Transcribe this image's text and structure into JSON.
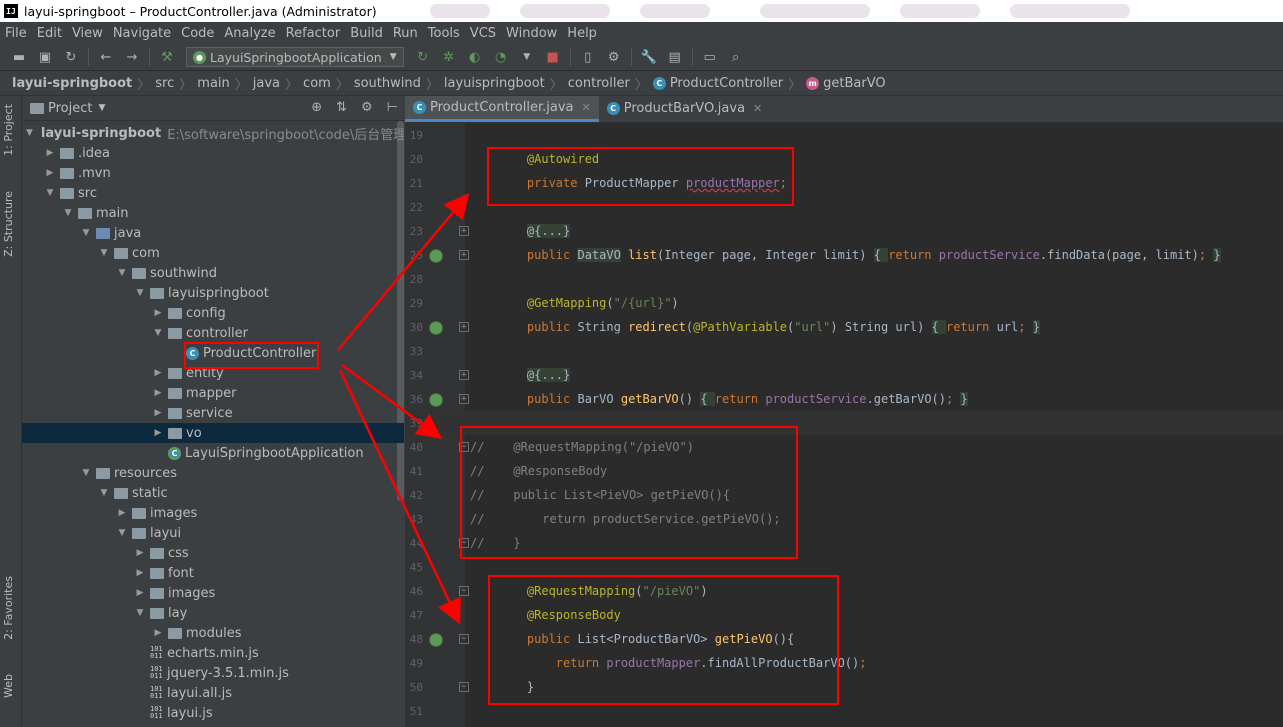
{
  "window": {
    "title": "layui-springboot – ProductController.java (Administrator)"
  },
  "menu": [
    "File",
    "Edit",
    "View",
    "Navigate",
    "Code",
    "Analyze",
    "Refactor",
    "Build",
    "Run",
    "Tools",
    "VCS",
    "Window",
    "Help"
  ],
  "toolbar": {
    "run_config": "LayuiSpringbootApplication"
  },
  "breadcrumb": [
    "layui-springboot",
    "src",
    "main",
    "java",
    "com",
    "southwind",
    "layuispringboot",
    "controller",
    "ProductController",
    "getBarVO"
  ],
  "left_strip": {
    "project": "1: Project",
    "structure": "Z: Structure",
    "favorites": "2: Favorites",
    "web": "Web"
  },
  "project_panel": {
    "title": "Project",
    "root_path": "E:\\software\\springboot\\code\\后台管理\\",
    "tree": [
      {
        "label": "layui-springboot",
        "depth": 0,
        "kind": "module",
        "open": true
      },
      {
        "label": ".idea",
        "depth": 1,
        "kind": "folder",
        "open": false
      },
      {
        "label": ".mvn",
        "depth": 1,
        "kind": "folder",
        "open": false
      },
      {
        "label": "src",
        "depth": 1,
        "kind": "folder",
        "open": true
      },
      {
        "label": "main",
        "depth": 2,
        "kind": "folder",
        "open": true
      },
      {
        "label": "java",
        "depth": 3,
        "kind": "srcfolder",
        "open": true
      },
      {
        "label": "com",
        "depth": 4,
        "kind": "package",
        "open": true
      },
      {
        "label": "southwind",
        "depth": 5,
        "kind": "package",
        "open": true
      },
      {
        "label": "layuispringboot",
        "depth": 6,
        "kind": "package",
        "open": true
      },
      {
        "label": "config",
        "depth": 7,
        "kind": "package",
        "open": false
      },
      {
        "label": "controller",
        "depth": 7,
        "kind": "package",
        "open": true
      },
      {
        "label": "ProductController",
        "depth": 8,
        "kind": "class",
        "open": null
      },
      {
        "label": "entity",
        "depth": 7,
        "kind": "package",
        "open": false
      },
      {
        "label": "mapper",
        "depth": 7,
        "kind": "package",
        "open": false
      },
      {
        "label": "service",
        "depth": 7,
        "kind": "package",
        "open": false
      },
      {
        "label": "vo",
        "depth": 7,
        "kind": "package",
        "open": false,
        "selected": true
      },
      {
        "label": "LayuiSpringbootApplication",
        "depth": 7,
        "kind": "springclass",
        "open": null
      },
      {
        "label": "resources",
        "depth": 3,
        "kind": "folder",
        "open": true
      },
      {
        "label": "static",
        "depth": 4,
        "kind": "folder",
        "open": true
      },
      {
        "label": "images",
        "depth": 5,
        "kind": "folder",
        "open": false
      },
      {
        "label": "layui",
        "depth": 5,
        "kind": "folder",
        "open": true
      },
      {
        "label": "css",
        "depth": 6,
        "kind": "folder",
        "open": false
      },
      {
        "label": "font",
        "depth": 6,
        "kind": "folder",
        "open": false
      },
      {
        "label": "images",
        "depth": 6,
        "kind": "folder",
        "open": false
      },
      {
        "label": "lay",
        "depth": 6,
        "kind": "folder",
        "open": true
      },
      {
        "label": "modules",
        "depth": 7,
        "kind": "folder",
        "open": false
      },
      {
        "label": "echarts.min.js",
        "depth": 6,
        "kind": "js",
        "open": null
      },
      {
        "label": "jquery-3.5.1.min.js",
        "depth": 6,
        "kind": "js",
        "open": null
      },
      {
        "label": "layui.all.js",
        "depth": 6,
        "kind": "js",
        "open": null
      },
      {
        "label": "layui.js",
        "depth": 6,
        "kind": "js",
        "open": null
      }
    ]
  },
  "editor": {
    "tabs": [
      {
        "label": "ProductController.java",
        "active": true
      },
      {
        "label": "ProductBarVO.java",
        "active": false
      }
    ],
    "lines": [
      {
        "n": "19",
        "segs": []
      },
      {
        "n": "20",
        "segs": [
          {
            "t": "    "
          },
          {
            "t": "@Autowired",
            "c": "an"
          }
        ]
      },
      {
        "n": "21",
        "segs": [
          {
            "t": "    "
          },
          {
            "t": "private ",
            "c": "kw"
          },
          {
            "t": "ProductMapper "
          },
          {
            "t": "productMapper",
            "c": "fld ul"
          },
          {
            "t": ";",
            "c": "kw"
          }
        ]
      },
      {
        "n": "22",
        "segs": []
      },
      {
        "n": "23",
        "segs": [
          {
            "t": "    "
          },
          {
            "t": "@{...}",
            "c": "hl"
          }
        ],
        "fold": "+"
      },
      {
        "n": "25",
        "segs": [
          {
            "t": "    "
          },
          {
            "t": "public ",
            "c": "kw"
          },
          {
            "t": "DataVO",
            "c": "hl"
          },
          {
            "t": " "
          },
          {
            "t": "list",
            "c": "fn"
          },
          {
            "t": "(Integer page, Integer limit) "
          },
          {
            "t": "{ ",
            "c": "hl"
          },
          {
            "t": "return ",
            "c": "kw"
          },
          {
            "t": "productService",
            "c": "fld"
          },
          {
            "t": ".findData(page, limit)"
          },
          {
            "t": "; ",
            "c": "kw"
          },
          {
            "t": "}",
            "c": "hl"
          }
        ],
        "fold": "+",
        "gicon": true
      },
      {
        "n": "28",
        "segs": []
      },
      {
        "n": "29",
        "segs": [
          {
            "t": "    "
          },
          {
            "t": "@GetMapping",
            "c": "an"
          },
          {
            "t": "("
          },
          {
            "t": "\"/{url}\"",
            "c": "st"
          },
          {
            "t": ")"
          }
        ]
      },
      {
        "n": "30",
        "segs": [
          {
            "t": "    "
          },
          {
            "t": "public ",
            "c": "kw"
          },
          {
            "t": "String "
          },
          {
            "t": "redirect",
            "c": "fn"
          },
          {
            "t": "("
          },
          {
            "t": "@PathVariable",
            "c": "an"
          },
          {
            "t": "("
          },
          {
            "t": "\"url\"",
            "c": "st"
          },
          {
            "t": ") String url) "
          },
          {
            "t": "{ ",
            "c": "hl"
          },
          {
            "t": "return ",
            "c": "kw"
          },
          {
            "t": "url"
          },
          {
            "t": "; ",
            "c": "kw"
          },
          {
            "t": "}",
            "c": "hl"
          }
        ],
        "fold": "+",
        "gicon": true
      },
      {
        "n": "33",
        "segs": []
      },
      {
        "n": "34",
        "segs": [
          {
            "t": "    "
          },
          {
            "t": "@{...}",
            "c": "hl"
          }
        ],
        "fold": "+"
      },
      {
        "n": "36",
        "segs": [
          {
            "t": "    "
          },
          {
            "t": "public ",
            "c": "kw"
          },
          {
            "t": "BarVO "
          },
          {
            "t": "getBarVO",
            "c": "fn"
          },
          {
            "t": "() "
          },
          {
            "t": "{ ",
            "c": "hl"
          },
          {
            "t": "return ",
            "c": "kw"
          },
          {
            "t": "productService",
            "c": "fld"
          },
          {
            "t": ".getBarVO()"
          },
          {
            "t": "; ",
            "c": "kw"
          },
          {
            "t": "}",
            "c": "hl"
          }
        ],
        "fold": "+",
        "gicon": true
      },
      {
        "n": "39",
        "segs": [],
        "cur": true
      },
      {
        "n": "40",
        "segs": [
          {
            "t": "//    @RequestMapping(\"/pieVO\")",
            "c": "cm"
          }
        ],
        "fold": "-"
      },
      {
        "n": "41",
        "segs": [
          {
            "t": "//    @ResponseBody",
            "c": "cm"
          }
        ]
      },
      {
        "n": "42",
        "segs": [
          {
            "t": "//    public List<PieVO> getPieVO(){",
            "c": "cm"
          }
        ]
      },
      {
        "n": "43",
        "segs": [
          {
            "t": "//        return productService.getPieVO();",
            "c": "cm"
          }
        ]
      },
      {
        "n": "44",
        "segs": [
          {
            "t": "//    }",
            "c": "cm"
          }
        ],
        "fold": "-"
      },
      {
        "n": "45",
        "segs": []
      },
      {
        "n": "46",
        "segs": [
          {
            "t": "    "
          },
          {
            "t": "@RequestMapping",
            "c": "an"
          },
          {
            "t": "("
          },
          {
            "t": "\"/pieVO\"",
            "c": "st"
          },
          {
            "t": ")"
          }
        ],
        "fold": "-"
      },
      {
        "n": "47",
        "segs": [
          {
            "t": "    "
          },
          {
            "t": "@ResponseBody",
            "c": "an"
          }
        ]
      },
      {
        "n": "48",
        "segs": [
          {
            "t": "    "
          },
          {
            "t": "public ",
            "c": "kw"
          },
          {
            "t": "List<ProductBarVO> "
          },
          {
            "t": "getPieVO",
            "c": "fn"
          },
          {
            "t": "(){"
          }
        ],
        "fold": "-",
        "gicon": true
      },
      {
        "n": "49",
        "segs": [
          {
            "t": "        "
          },
          {
            "t": "return ",
            "c": "kw"
          },
          {
            "t": "productMapper",
            "c": "fld"
          },
          {
            "t": ".findAllProductBarVO()"
          },
          {
            "t": ";",
            "c": "kw"
          }
        ]
      },
      {
        "n": "50",
        "segs": [
          {
            "t": "    }"
          }
        ],
        "fold": "-"
      },
      {
        "n": "51",
        "segs": []
      }
    ]
  },
  "colors": {
    "annotation_box": "#ff0000",
    "arrow": "#ff0000",
    "accent": "#4a88c7"
  }
}
